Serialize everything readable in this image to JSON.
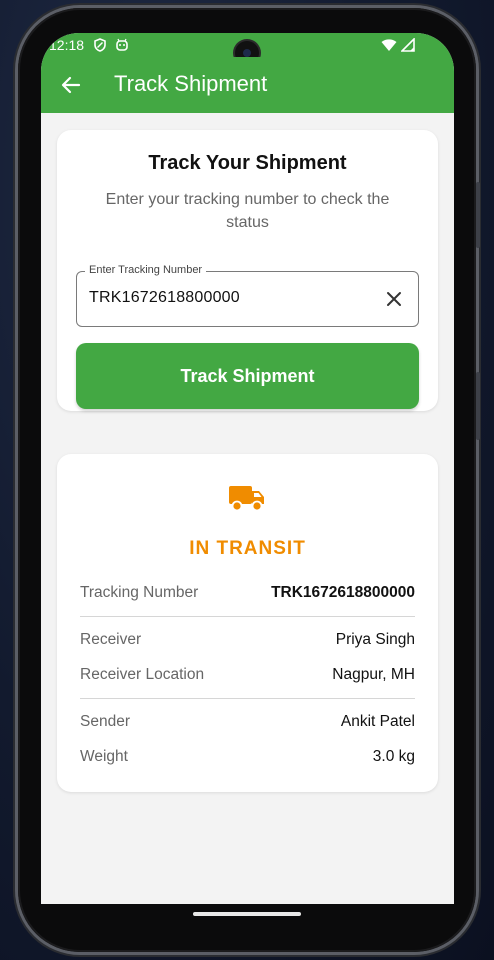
{
  "status_bar": {
    "time": "12:18"
  },
  "app_bar": {
    "title": "Track Shipment"
  },
  "search_card": {
    "title": "Track Your Shipment",
    "subtitle": "Enter your tracking number to check the status",
    "field_label": "Enter Tracking Number",
    "field_value": "TRK1672618800000",
    "button_label": "Track Shipment"
  },
  "result_card": {
    "icon": "truck-icon",
    "status": "IN TRANSIT",
    "rows": [
      {
        "label": "Tracking Number",
        "value": "TRK1672618800000"
      },
      {
        "label": "Receiver",
        "value": "Priya Singh"
      },
      {
        "label": "Receiver Location",
        "value": "Nagpur, MH"
      },
      {
        "label": "Sender",
        "value": "Ankit Patel"
      },
      {
        "label": "Weight",
        "value": "3.0 kg"
      }
    ]
  },
  "colors": {
    "primary": "#43a843",
    "status_accent": "#f08c00",
    "background": "#f3f3f3"
  }
}
